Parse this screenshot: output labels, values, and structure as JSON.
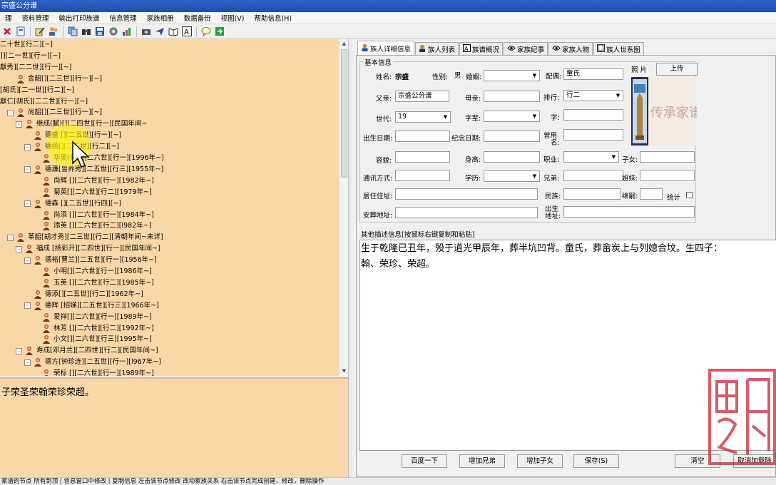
{
  "window": {
    "title": "宗盛公分谱"
  },
  "menu": [
    "理",
    "资料管理",
    "输出打印族谱",
    "信息管理",
    "家族相册",
    "数据备份",
    "视图(V)",
    "帮助信息(H)"
  ],
  "toolbar_icons": [
    "close-icon",
    "new-icon",
    "edit-icon",
    "users-icon",
    "copy-icon",
    "binoculars-icon",
    "save-icon",
    "settings-icon",
    "chart-icon",
    "camera-icon",
    "send-icon",
    "book-icon",
    "font-icon",
    "help-icon",
    "exit-icon"
  ],
  "tree": {
    "rows": [
      {
        "text": "二十世][行二][~]",
        "indent": 0,
        "icon": false,
        "exp": ""
      },
      {
        "text": "]][二一世][行一][~]",
        "indent": 0,
        "icon": false,
        "exp": ""
      },
      {
        "text": "獻秀][二二世][行一][~]",
        "indent": 0,
        "icon": false,
        "exp": ""
      },
      {
        "text": "金韶[][二三世][行一][~]",
        "indent": 1,
        "icon": true,
        "exp": ""
      },
      {
        "text": "[胡氏][二一世][行二][~]",
        "indent": 0,
        "icon": false,
        "exp": ""
      },
      {
        "text": "獻仁[胡氏][二二世][行一][~]",
        "indent": 0,
        "icon": false,
        "exp": ""
      },
      {
        "text": "尚韶[][二三世][行一][~]",
        "indent": 1,
        "icon": true,
        "exp": "-"
      },
      {
        "text": "继成(膩)[][二四世][行一][民国年间~",
        "indent": 2,
        "icon": true,
        "exp": "-"
      },
      {
        "text": "德盛 [][二五世][行一][~]",
        "indent": 3,
        "icon": true,
        "exp": ""
      },
      {
        "text": "德扬[][二五世][行二][~]",
        "indent": 3,
        "icon": true,
        "exp": "-"
      },
      {
        "text": "华英(养)[][二六世][行一][1996年~]",
        "indent": 4,
        "icon": true,
        "exp": ""
      },
      {
        "text": "德濂[曾养秀][二五世][行三][1955年~]",
        "indent": 3,
        "icon": true,
        "exp": "-"
      },
      {
        "text": "尚辉 [][二六世][行一][1982年~]",
        "indent": 4,
        "icon": true,
        "exp": ""
      },
      {
        "text": "菊英[][二六世][行二][1979年~]",
        "indent": 4,
        "icon": true,
        "exp": ""
      },
      {
        "text": "德森 [][二五世][行四][~]",
        "indent": 3,
        "icon": true,
        "exp": "-"
      },
      {
        "text": "尚添 [][二六世][行一][1984年~]",
        "indent": 4,
        "icon": true,
        "exp": ""
      },
      {
        "text": "添英 [][二六世][行二][l982年~]",
        "indent": 4,
        "icon": true,
        "exp": ""
      },
      {
        "text": "革韶[胡才秀][二三世][行二][清朝年间~未详]",
        "indent": 1,
        "icon": true,
        "exp": "-"
      },
      {
        "text": "福成 [扬彩开][二四世][行一][民国年间~]",
        "indent": 2,
        "icon": true,
        "exp": "-"
      },
      {
        "text": "德裕[曹兰][二五世][行一][1956年~]",
        "indent": 3,
        "icon": true,
        "exp": "-"
      },
      {
        "text": "小明[][二六世][行一][1986年~]",
        "indent": 4,
        "icon": true,
        "exp": ""
      },
      {
        "text": "玉英 [][二六世][行二][1985年~]",
        "indent": 4,
        "icon": true,
        "exp": ""
      },
      {
        "text": "德添[][二五世][行二][1962年~]",
        "indent": 3,
        "icon": true,
        "exp": ""
      },
      {
        "text": "德辉 [招娣][二五世][行三][1966年~]",
        "indent": 3,
        "icon": true,
        "exp": "-"
      },
      {
        "text": "爱祥[][二六世][行一][1989年~]",
        "indent": 4,
        "icon": true,
        "exp": ""
      },
      {
        "text": "林芳 [][二六世][行二][1992年~]",
        "indent": 4,
        "icon": true,
        "exp": ""
      },
      {
        "text": "小文[][二六世][行三][1995年~]",
        "indent": 4,
        "icon": true,
        "exp": ""
      },
      {
        "text": "寿成[邓月兰][二四世][行二][民国年间~]",
        "indent": 2,
        "icon": true,
        "exp": "-"
      },
      {
        "text": "德方[钟珍连][二五世][行一][l967年~]",
        "indent": 3,
        "icon": true,
        "exp": "-"
      },
      {
        "text": "荣标 [][二六世][行一][1989年~]",
        "indent": 4,
        "icon": true,
        "exp": ""
      }
    ]
  },
  "left_note": "子荣圣荣翰荣珍荣超。",
  "tabs": [
    {
      "label": "族人详细信息",
      "icon": "person-icon",
      "active": true
    },
    {
      "label": "族人列表",
      "icon": "person-list-icon",
      "active": false
    },
    {
      "label": "族谱概况",
      "icon": "text-icon",
      "active": false
    },
    {
      "label": "家族纪事",
      "icon": "eye-icon",
      "active": false
    },
    {
      "label": "家族人物",
      "icon": "eye-icon",
      "active": false
    },
    {
      "label": "族人世系图",
      "icon": "tree-icon",
      "active": false
    }
  ],
  "basic_info": {
    "title": "基本信息",
    "name_label": "姓名:",
    "name_value": "宗盛",
    "gender_label": "性别:",
    "gender_value": "男",
    "marital_label": "婚姻:",
    "marital_value": "",
    "spouse_label": "配偶:",
    "spouse_value": "童氏",
    "photo_label": "照 片",
    "upload_label": "上传",
    "father_label": "父亲:",
    "father_value": "宗盛公分谱",
    "mother_label": "母亲:",
    "mother_value": "",
    "rank_label": "排行:",
    "rank_value": "行二",
    "gen_label": "世代:",
    "gen_value": "19",
    "zibei_label": "字辈:",
    "zibei_value": "",
    "zi_label": "字:",
    "zi_value": "",
    "birth_label": "出生日期:",
    "birth_value": "",
    "memorial_label": "纪念日期:",
    "memorial_value": "",
    "former_name_label_1": "曾用",
    "former_name_label_2": "名:",
    "former_name_value": "",
    "face_label": "容貌:",
    "face_value": "",
    "height_label": "身高:",
    "height_value": "",
    "job_label": "职业:",
    "job_value": "",
    "children_label": "子女:",
    "children_value": "",
    "contact_label": "通讯方式:",
    "contact_value": "",
    "edu_label": "学历:",
    "edu_value": "",
    "brothers_label": "兄弟:",
    "brothers_value": "",
    "sisters_label": "姐妹:",
    "sisters_value": "",
    "address_label": "居住住址:",
    "address_value": "",
    "ethnic_label": "民族:",
    "ethnic_value": "",
    "succession_label": "继嗣:",
    "succession_value": "",
    "stats_label": "统计",
    "burial_label": "安葬地址:",
    "burial_value": "",
    "birthplace_label_1": "出生",
    "birthplace_label_2": "地址:",
    "birthplace_value": ""
  },
  "other_info": {
    "title": "其他描述信息[按鼠标右键复制和粘贴]",
    "line1": "生于乾隆已丑年，殁于道光甲辰年，葬半坑凹背。童氏，葬畲炭上与列媳合坟。生四子：",
    "line2": "翰、荣珍、荣超。"
  },
  "buttons": {
    "baidu": "百度一下",
    "add_brother": "增加兄弟",
    "add_child": "增加子女",
    "save": "保存(S)",
    "clear": "清空",
    "cancel": "取消加载除"
  },
  "photo_text": "传承家谱",
  "status": "家谱的节点 所有到顶 | 信息窗口中修改 | 复制信息 左击该节点修改 改动家族关系 右击该节点完成创建，修改，删除操作"
}
